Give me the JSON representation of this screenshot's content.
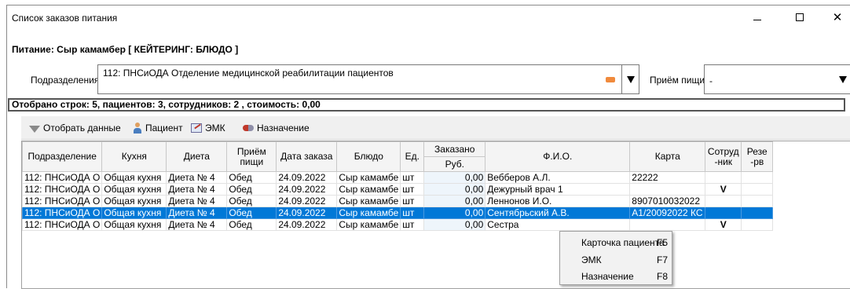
{
  "window": {
    "title": "Список заказов питания",
    "controls": {
      "minimize": "minimize-icon",
      "maximize": "maximize-icon",
      "close_glyph": "✕"
    }
  },
  "food_title": "Питание: Сыр камамбер [ КЕЙТЕРИНГ: БЛЮДО ]",
  "filters": {
    "department_label": "Подразделения",
    "department_value": "112: ПНСиОДА Отделение медицинской реабилитации пациентов",
    "meal_label": "Приём пищи",
    "meal_value": "-"
  },
  "status_text": "Отобрано строк: 5, пациентов: 3, сотрудников: 2 , стоимость: 0,00",
  "toolbar": {
    "show_data": "Отобрать данные",
    "patient": "Пациент",
    "emk": "ЭМК",
    "assignment": "Назначение"
  },
  "table": {
    "headers": {
      "department": "Подразделение",
      "kitchen": "Кухня",
      "diet": "Диета",
      "meal": "Приём пищи",
      "order_date": "Дата заказа",
      "dish": "Блюдо",
      "unit": "Ед.",
      "ordered": "Заказано",
      "rub": "Руб.",
      "fio": "Ф.И.О.",
      "card": "Карта",
      "employee": "Сотруд -ник",
      "reserve": "Резе -рв"
    },
    "rows": [
      {
        "department": "112: ПНСиОДА О",
        "kitchen": "Общая кухня",
        "diet": "Диета № 4",
        "meal": "Обед",
        "date": "24.09.2022",
        "dish": "Сыр камамбе",
        "unit": "шт",
        "rub": "0,00",
        "fio": "Вебберов А.Л.",
        "card": "22222",
        "employee": "",
        "reserve": ""
      },
      {
        "department": "112: ПНСиОДА О",
        "kitchen": "Общая кухня",
        "diet": "Диета № 4",
        "meal": "Обед",
        "date": "24.09.2022",
        "dish": "Сыр камамбе",
        "unit": "шт",
        "rub": "0,00",
        "fio": "Дежурный врач 1",
        "card": "",
        "employee": "V",
        "reserve": ""
      },
      {
        "department": "112: ПНСиОДА О",
        "kitchen": "Общая кухня",
        "diet": "Диета № 4",
        "meal": "Обед",
        "date": "24.09.2022",
        "dish": "Сыр камамбе",
        "unit": "шт",
        "rub": "0,00",
        "fio": "Леннонов И.О.",
        "card": "8907010032022",
        "employee": "",
        "reserve": ""
      },
      {
        "department": "112: ПНСиОДА О",
        "kitchen": "Общая кухня",
        "diet": "Диета № 4",
        "meal": "Обед",
        "date": "24.09.2022",
        "dish": "Сыр камамбе",
        "unit": "шт",
        "rub": "0,00",
        "fio": "Сентябрьский А.В.",
        "card": "А1/20092022 КС",
        "employee": "",
        "reserve": ""
      },
      {
        "department": "112: ПНСиОДА О",
        "kitchen": "Общая кухня",
        "diet": "Диета № 4",
        "meal": "Обед",
        "date": "24.09.2022",
        "dish": "Сыр камамбе",
        "unit": "шт",
        "rub": "0,00",
        "fio": "Сестра",
        "card": "",
        "employee": "V",
        "reserve": ""
      }
    ],
    "selected_row": 3
  },
  "context_menu": [
    {
      "label": "Карточка пациента",
      "key": "F5"
    },
    {
      "label": "ЭМК",
      "key": "F7"
    },
    {
      "label": "Назначение",
      "key": "F8"
    }
  ],
  "colors": {
    "selection": "#0078d7",
    "clear_icon": "#f08a3c"
  }
}
